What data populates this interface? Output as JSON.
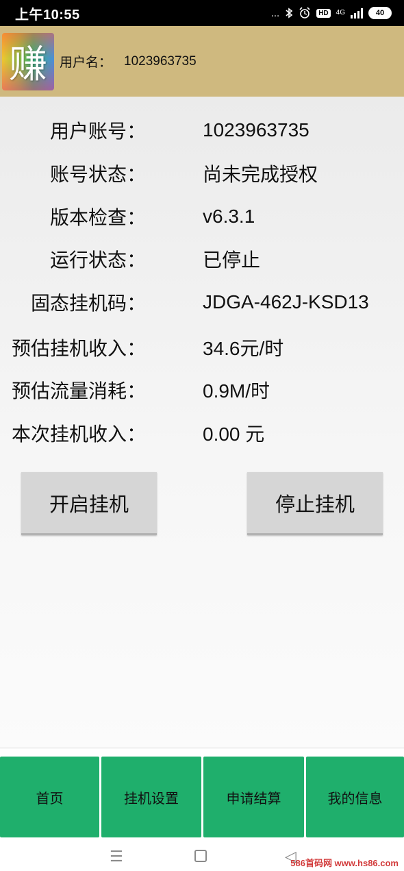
{
  "status_bar": {
    "time": "上午10:55",
    "dots": "...",
    "hd": "HD",
    "network": "4G",
    "battery": "40"
  },
  "header": {
    "logo_char": "赚",
    "user_label": "用户名：",
    "user_value": "1023963735"
  },
  "info": [
    {
      "label": "用户账号：",
      "value": "1023963735"
    },
    {
      "label": "账号状态：",
      "value": "尚未完成授权"
    },
    {
      "label": "版本检查：",
      "value": "v6.3.1"
    },
    {
      "label": "运行状态：",
      "value": "已停止"
    },
    {
      "label": "固态挂机码：",
      "value": "JDGA-462J-KSD13"
    },
    {
      "label": "预估挂机收入：",
      "value": "34.6元/时"
    },
    {
      "label": "预估流量消耗：",
      "value": "0.9M/时"
    },
    {
      "label": "本次挂机收入：",
      "value": "0.00 元"
    }
  ],
  "buttons": {
    "start": "开启挂机",
    "stop": "停止挂机"
  },
  "tabs": [
    {
      "label": "首页"
    },
    {
      "label": "挂机设置"
    },
    {
      "label": "申请结算"
    },
    {
      "label": "我的信息"
    }
  ],
  "navbar": {
    "menu_glyph": "☰",
    "back_glyph": "◁"
  },
  "watermark": "586首码网 www.hs86.com",
  "colors": {
    "header_bg": "#cfb97f",
    "tab_bg": "#1faf6c",
    "button_bg": "#d6d6d6"
  }
}
